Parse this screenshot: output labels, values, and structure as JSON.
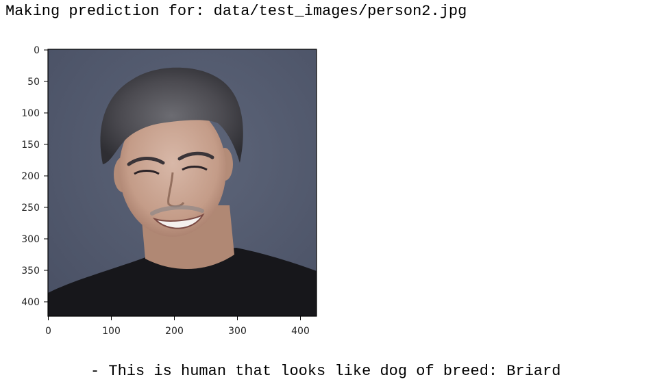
{
  "output": {
    "prediction_line": "Making prediction for: data/test_images/person2.jpg",
    "result_line": "- This is human that looks like dog of breed: Briard"
  },
  "image_plot": {
    "content": "photo of a smiling man with gray curly hair in a black sweater against a blue-gray background",
    "background_color": "#555d72",
    "x_ticks": [
      "0",
      "100",
      "200",
      "300",
      "400"
    ],
    "y_ticks": [
      "0",
      "50",
      "100",
      "150",
      "200",
      "250",
      "300",
      "350",
      "400"
    ]
  }
}
